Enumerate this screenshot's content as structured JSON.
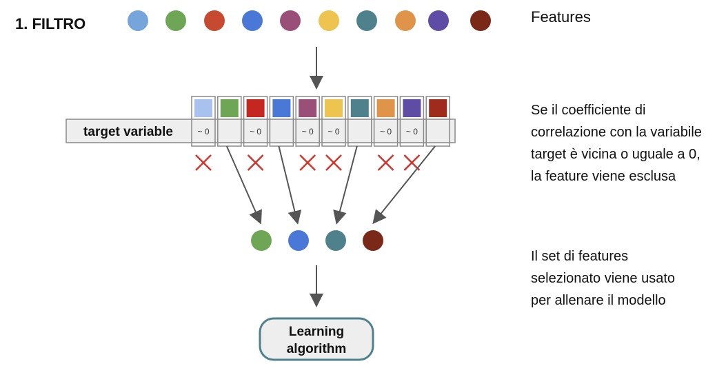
{
  "title": "1. FILTRO",
  "features_label": "Features",
  "target_label": "target variable",
  "learning_label": "Learning algorithm",
  "desc1": "Se il coefficiente di correlazione con la variabile target è vicina o uguale a 0, la feature viene esclusa",
  "desc2": "Il set di features selezionato viene usato per allenare il modello",
  "features": [
    {
      "color": "#76a5dc",
      "cell": "#a9c1ef",
      "corr": "~ 0",
      "excluded": true
    },
    {
      "color": "#6fa655",
      "cell": "#6fa655",
      "corr": "",
      "excluded": false
    },
    {
      "color": "#c64a30",
      "cell": "#c4271f",
      "corr": "~ 0",
      "excluded": true
    },
    {
      "color": "#4a78d6",
      "cell": "#4a78d6",
      "corr": "",
      "excluded": false
    },
    {
      "color": "#9a4f78",
      "cell": "#9a4f78",
      "corr": "~ 0",
      "excluded": true
    },
    {
      "color": "#ecc44f",
      "cell": "#ecc44f",
      "corr": "~ 0",
      "excluded": true
    },
    {
      "color": "#4e818b",
      "cell": "#4e818b",
      "corr": "",
      "excluded": false
    },
    {
      "color": "#e0944a",
      "cell": "#e0944a",
      "corr": "~ 0",
      "excluded": true
    },
    {
      "color": "#5f4ca4",
      "cell": "#5f4ca4",
      "corr": "~ 0",
      "excluded": true
    },
    {
      "color": "#7a2918",
      "cell": "#9e2b1b",
      "corr": "",
      "excluded": false
    }
  ],
  "colors": {
    "cross": "#d2352b",
    "arrow": "#555555",
    "box_border": "#4e818b"
  }
}
